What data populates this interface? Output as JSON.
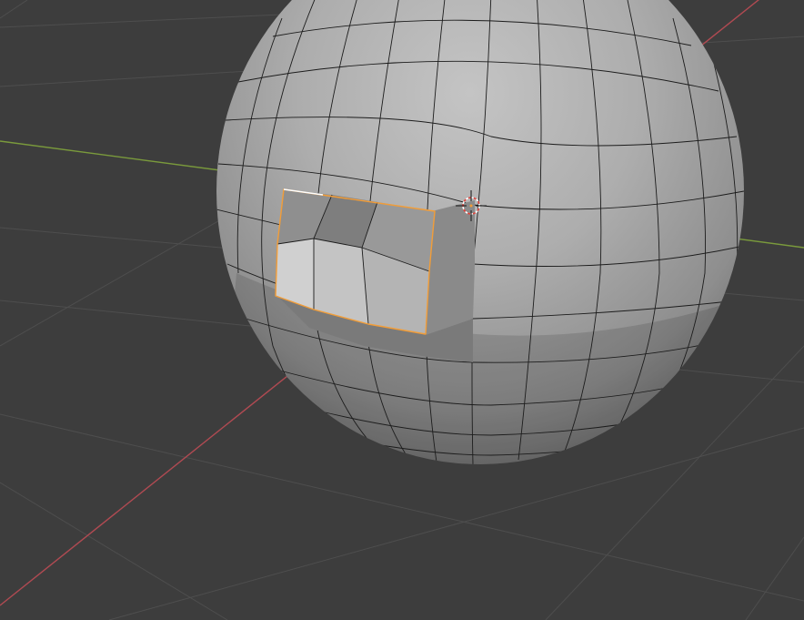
{
  "viewport": {
    "background_color": "#3d3d3d",
    "grid_color": "#4e4e4e",
    "x_axis_color": "#b04a52",
    "y_axis_color": "#7a9a3c",
    "mesh_face_color": "#a9a9a9",
    "mesh_edge_color": "#1c1c1c",
    "selection_color": "#f29d38",
    "active_edge_color": "#ffffff",
    "cursor_icon": "3d-cursor-icon",
    "mode": "edit-mode",
    "object": "uv-sphere"
  }
}
